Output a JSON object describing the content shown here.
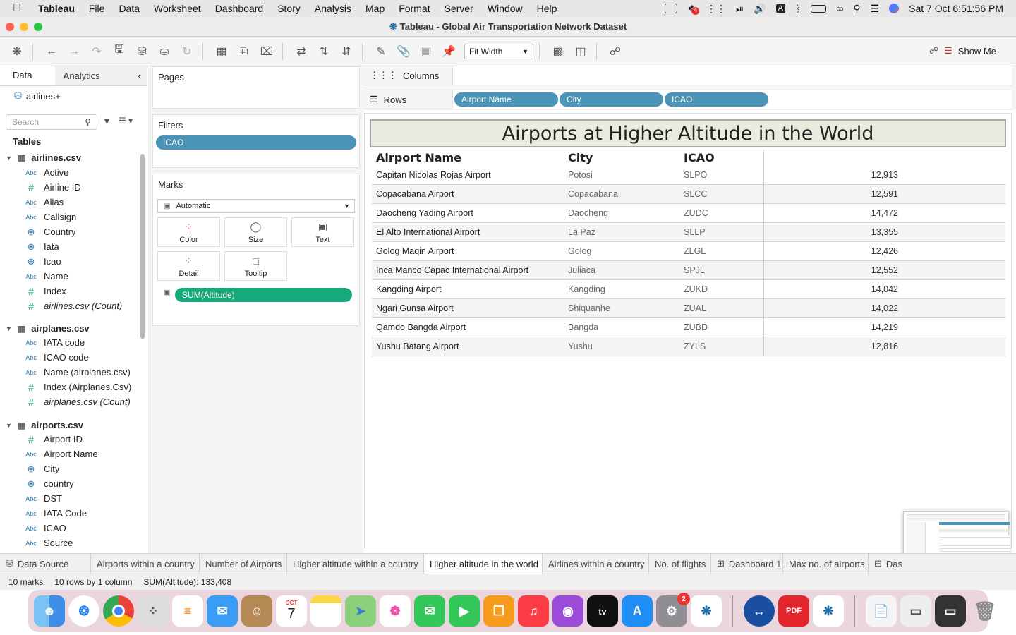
{
  "menubar": {
    "app_name": "Tableau",
    "items": [
      "File",
      "Data",
      "Worksheet",
      "Dashboard",
      "Story",
      "Analysis",
      "Map",
      "Format",
      "Server",
      "Window",
      "Help"
    ],
    "clock": "Sat 7 Oct  6:51:56 PM",
    "badge_count": "4"
  },
  "window": {
    "title": "Tableau - Global Air Transportation Network Dataset"
  },
  "toolbar": {
    "fit_label": "Fit Width",
    "show_me_label": "Show Me"
  },
  "data_pane": {
    "tab_data": "Data",
    "tab_analytics": "Analytics",
    "datasource": "airlines+",
    "search_placeholder": "Search",
    "tables_header": "Tables",
    "tables": [
      {
        "name": "airlines.csv",
        "fields": [
          {
            "type": "Abc",
            "name": "Active"
          },
          {
            "type": "#",
            "name": "Airline ID"
          },
          {
            "type": "Abc",
            "name": "Alias"
          },
          {
            "type": "Abc",
            "name": "Callsign"
          },
          {
            "type": "geo",
            "name": "Country"
          },
          {
            "type": "geo",
            "name": "Iata"
          },
          {
            "type": "geo",
            "name": "Icao"
          },
          {
            "type": "Abc",
            "name": "Name"
          },
          {
            "type": "#",
            "name": "Index"
          },
          {
            "type": "#",
            "name": "airlines.csv (Count)"
          }
        ]
      },
      {
        "name": "airplanes.csv",
        "fields": [
          {
            "type": "Abc",
            "name": "IATA code"
          },
          {
            "type": "Abc",
            "name": "ICAO code"
          },
          {
            "type": "Abc",
            "name": "Name (airplanes.csv)"
          },
          {
            "type": "#",
            "name": "Index (Airplanes.Csv)"
          },
          {
            "type": "#",
            "name": "airplanes.csv (Count)"
          }
        ]
      },
      {
        "name": "airports.csv",
        "fields": [
          {
            "type": "#",
            "name": "Airport ID"
          },
          {
            "type": "Abc",
            "name": "Airport Name"
          },
          {
            "type": "geo",
            "name": "City"
          },
          {
            "type": "geo",
            "name": "country"
          },
          {
            "type": "Abc",
            "name": "DST"
          },
          {
            "type": "Abc",
            "name": "IATA Code"
          },
          {
            "type": "Abc",
            "name": "ICAO"
          },
          {
            "type": "Abc",
            "name": "Source"
          }
        ]
      }
    ]
  },
  "cards": {
    "pages_label": "Pages",
    "filters_label": "Filters",
    "filter_pill": "ICAO",
    "marks_label": "Marks",
    "mark_type": "Automatic",
    "mark_buttons": [
      "Color",
      "Size",
      "Text",
      "Detail",
      "Tooltip"
    ],
    "mark_pill": "SUM(Altitude)"
  },
  "shelves": {
    "columns_label": "Columns",
    "rows_label": "Rows",
    "row_pills": [
      "Airport Name",
      "City",
      "ICAO"
    ]
  },
  "view": {
    "title": "Airports at Higher Altitude in the World",
    "headers": [
      "Airport Name",
      "City",
      "ICAO"
    ],
    "rows": [
      [
        "Capitan Nicolas Rojas Airport",
        "Potosi",
        "SLPO",
        "12,913"
      ],
      [
        "Copacabana Airport",
        "Copacabana",
        "SLCC",
        "12,591"
      ],
      [
        "Daocheng Yading Airport",
        "Daocheng",
        "ZUDC",
        "14,472"
      ],
      [
        "El Alto International Airport",
        "La Paz",
        "SLLP",
        "13,355"
      ],
      [
        "Golog Maqin Airport",
        "Golog",
        "ZLGL",
        "12,426"
      ],
      [
        "Inca Manco Capac International Airport",
        "Juliaca",
        "SPJL",
        "12,552"
      ],
      [
        "Kangding Airport",
        "Kangding",
        "ZUKD",
        "14,042"
      ],
      [
        "Ngari Gunsa Airport",
        "Shiquanhe",
        "ZUAL",
        "14,022"
      ],
      [
        "Qamdo Bangda Airport",
        "Bangda",
        "ZUBD",
        "14,219"
      ],
      [
        "Yushu Batang Airport",
        "Yushu",
        "ZYLS",
        "12,816"
      ]
    ]
  },
  "sheet_tabs": [
    "Data Source",
    "Airports within a country",
    "Number of Airports",
    "Higher altitude within a country",
    "Higher altitude in the world",
    "Airlines within a country",
    "No. of flights",
    "Dashboard 1",
    "Max no. of airports",
    "Das"
  ],
  "active_tab": "Higher altitude in the world",
  "status": {
    "marks": "10 marks",
    "rows_cols": "10 rows by 1 column",
    "sum": "SUM(Altitude): 133,408"
  },
  "dock": {
    "calendar_month": "OCT",
    "calendar_day": "7",
    "settings_badge": "2",
    "apps": [
      "finder-icon",
      "safari-icon",
      "chrome-icon",
      "launchpad-icon",
      "reminders-icon",
      "mail-icon",
      "contacts-icon",
      "calendar-icon",
      "notes-icon",
      "maps-icon",
      "photos-icon",
      "messages-icon",
      "facetime-icon",
      "books-icon",
      "music-icon",
      "podcasts-icon",
      "tv-icon",
      "appstore-icon",
      "settings-icon",
      "tableau-icon",
      "teamviewer-icon",
      "pdf-icon",
      "tableau2-icon",
      "documents-icon",
      "window-icon",
      "window2-icon",
      "trash-icon"
    ]
  }
}
